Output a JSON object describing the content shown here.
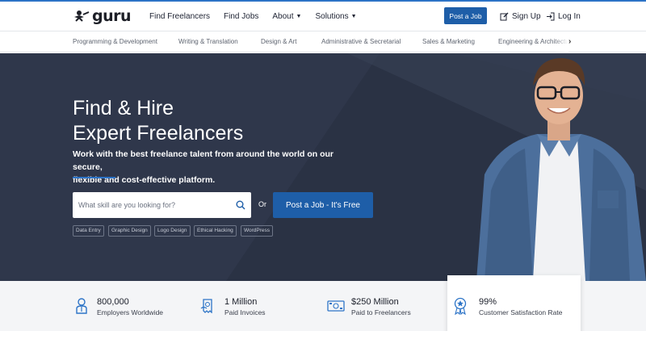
{
  "header": {
    "logo_text": "guru",
    "nav": [
      {
        "label": "Find Freelancers"
      },
      {
        "label": "Find Jobs"
      },
      {
        "label": "About"
      },
      {
        "label": "Solutions"
      }
    ],
    "post_job_label": "Post a Job",
    "sign_up_label": "Sign Up",
    "log_in_label": "Log In"
  },
  "categories": [
    "Programming & Development",
    "Writing & Translation",
    "Design & Art",
    "Administrative & Secretarial",
    "Sales & Marketing",
    "Engineering & Architecture"
  ],
  "hero": {
    "title_line1": "Find & Hire",
    "title_line2": "Expert Freelancers",
    "subtitle_line1": "Work with the best freelance talent from around the world on our secure,",
    "subtitle_line2": "flexible and cost-effective platform.",
    "search_placeholder": "What skill are you looking for?",
    "or_text": "Or",
    "cta_label": "Post a Job - It's Free",
    "tags": [
      "Data Entry",
      "Graphic Design",
      "Logo Design",
      "Ethical Hacking",
      "WordPress"
    ]
  },
  "stats": [
    {
      "value": "800,000",
      "label": "Employers Worldwide",
      "icon": "employer-icon"
    },
    {
      "value": "1 Million",
      "label": "Paid Invoices",
      "icon": "invoice-icon"
    },
    {
      "value": "$250 Million",
      "label": "Paid to Freelancers",
      "icon": "money-icon"
    },
    {
      "value": "99%",
      "label": "Customer Satisfaction Rate",
      "icon": "award-ribbon-icon"
    }
  ],
  "colors": {
    "brand_blue": "#1e5ea8",
    "hero_bg": "#2d3549",
    "accent_line": "#2d74c7"
  }
}
